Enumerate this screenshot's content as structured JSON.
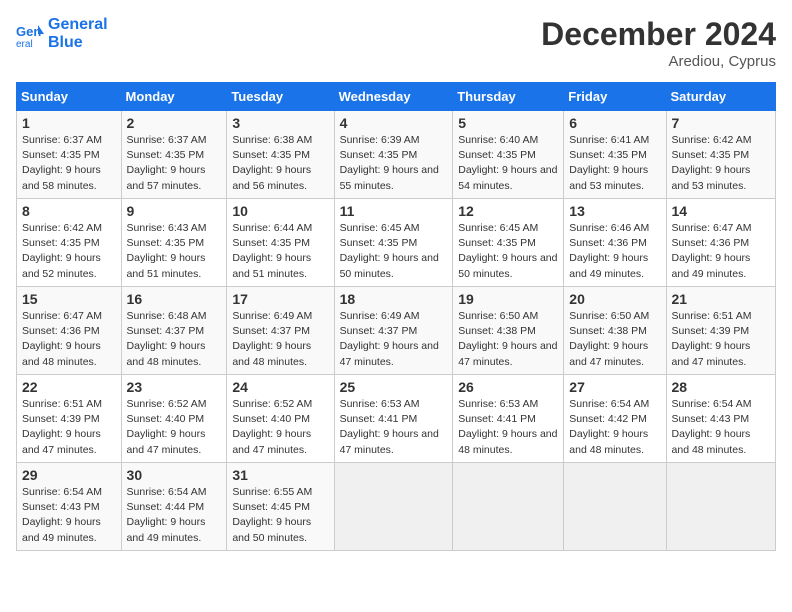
{
  "header": {
    "logo_line1": "General",
    "logo_line2": "Blue",
    "month": "December 2024",
    "location": "Arediou, Cyprus"
  },
  "weekdays": [
    "Sunday",
    "Monday",
    "Tuesday",
    "Wednesday",
    "Thursday",
    "Friday",
    "Saturday"
  ],
  "weeks": [
    [
      {
        "day": "1",
        "sunrise": "6:37 AM",
        "sunset": "4:35 PM",
        "daylight": "9 hours and 58 minutes."
      },
      {
        "day": "2",
        "sunrise": "6:37 AM",
        "sunset": "4:35 PM",
        "daylight": "9 hours and 57 minutes."
      },
      {
        "day": "3",
        "sunrise": "6:38 AM",
        "sunset": "4:35 PM",
        "daylight": "9 hours and 56 minutes."
      },
      {
        "day": "4",
        "sunrise": "6:39 AM",
        "sunset": "4:35 PM",
        "daylight": "9 hours and 55 minutes."
      },
      {
        "day": "5",
        "sunrise": "6:40 AM",
        "sunset": "4:35 PM",
        "daylight": "9 hours and 54 minutes."
      },
      {
        "day": "6",
        "sunrise": "6:41 AM",
        "sunset": "4:35 PM",
        "daylight": "9 hours and 53 minutes."
      },
      {
        "day": "7",
        "sunrise": "6:42 AM",
        "sunset": "4:35 PM",
        "daylight": "9 hours and 53 minutes."
      }
    ],
    [
      {
        "day": "8",
        "sunrise": "6:42 AM",
        "sunset": "4:35 PM",
        "daylight": "9 hours and 52 minutes."
      },
      {
        "day": "9",
        "sunrise": "6:43 AM",
        "sunset": "4:35 PM",
        "daylight": "9 hours and 51 minutes."
      },
      {
        "day": "10",
        "sunrise": "6:44 AM",
        "sunset": "4:35 PM",
        "daylight": "9 hours and 51 minutes."
      },
      {
        "day": "11",
        "sunrise": "6:45 AM",
        "sunset": "4:35 PM",
        "daylight": "9 hours and 50 minutes."
      },
      {
        "day": "12",
        "sunrise": "6:45 AM",
        "sunset": "4:35 PM",
        "daylight": "9 hours and 50 minutes."
      },
      {
        "day": "13",
        "sunrise": "6:46 AM",
        "sunset": "4:36 PM",
        "daylight": "9 hours and 49 minutes."
      },
      {
        "day": "14",
        "sunrise": "6:47 AM",
        "sunset": "4:36 PM",
        "daylight": "9 hours and 49 minutes."
      }
    ],
    [
      {
        "day": "15",
        "sunrise": "6:47 AM",
        "sunset": "4:36 PM",
        "daylight": "9 hours and 48 minutes."
      },
      {
        "day": "16",
        "sunrise": "6:48 AM",
        "sunset": "4:37 PM",
        "daylight": "9 hours and 48 minutes."
      },
      {
        "day": "17",
        "sunrise": "6:49 AM",
        "sunset": "4:37 PM",
        "daylight": "9 hours and 48 minutes."
      },
      {
        "day": "18",
        "sunrise": "6:49 AM",
        "sunset": "4:37 PM",
        "daylight": "9 hours and 47 minutes."
      },
      {
        "day": "19",
        "sunrise": "6:50 AM",
        "sunset": "4:38 PM",
        "daylight": "9 hours and 47 minutes."
      },
      {
        "day": "20",
        "sunrise": "6:50 AM",
        "sunset": "4:38 PM",
        "daylight": "9 hours and 47 minutes."
      },
      {
        "day": "21",
        "sunrise": "6:51 AM",
        "sunset": "4:39 PM",
        "daylight": "9 hours and 47 minutes."
      }
    ],
    [
      {
        "day": "22",
        "sunrise": "6:51 AM",
        "sunset": "4:39 PM",
        "daylight": "9 hours and 47 minutes."
      },
      {
        "day": "23",
        "sunrise": "6:52 AM",
        "sunset": "4:40 PM",
        "daylight": "9 hours and 47 minutes."
      },
      {
        "day": "24",
        "sunrise": "6:52 AM",
        "sunset": "4:40 PM",
        "daylight": "9 hours and 47 minutes."
      },
      {
        "day": "25",
        "sunrise": "6:53 AM",
        "sunset": "4:41 PM",
        "daylight": "9 hours and 47 minutes."
      },
      {
        "day": "26",
        "sunrise": "6:53 AM",
        "sunset": "4:41 PM",
        "daylight": "9 hours and 48 minutes."
      },
      {
        "day": "27",
        "sunrise": "6:54 AM",
        "sunset": "4:42 PM",
        "daylight": "9 hours and 48 minutes."
      },
      {
        "day": "28",
        "sunrise": "6:54 AM",
        "sunset": "4:43 PM",
        "daylight": "9 hours and 48 minutes."
      }
    ],
    [
      {
        "day": "29",
        "sunrise": "6:54 AM",
        "sunset": "4:43 PM",
        "daylight": "9 hours and 49 minutes."
      },
      {
        "day": "30",
        "sunrise": "6:54 AM",
        "sunset": "4:44 PM",
        "daylight": "9 hours and 49 minutes."
      },
      {
        "day": "31",
        "sunrise": "6:55 AM",
        "sunset": "4:45 PM",
        "daylight": "9 hours and 50 minutes."
      },
      null,
      null,
      null,
      null
    ]
  ]
}
